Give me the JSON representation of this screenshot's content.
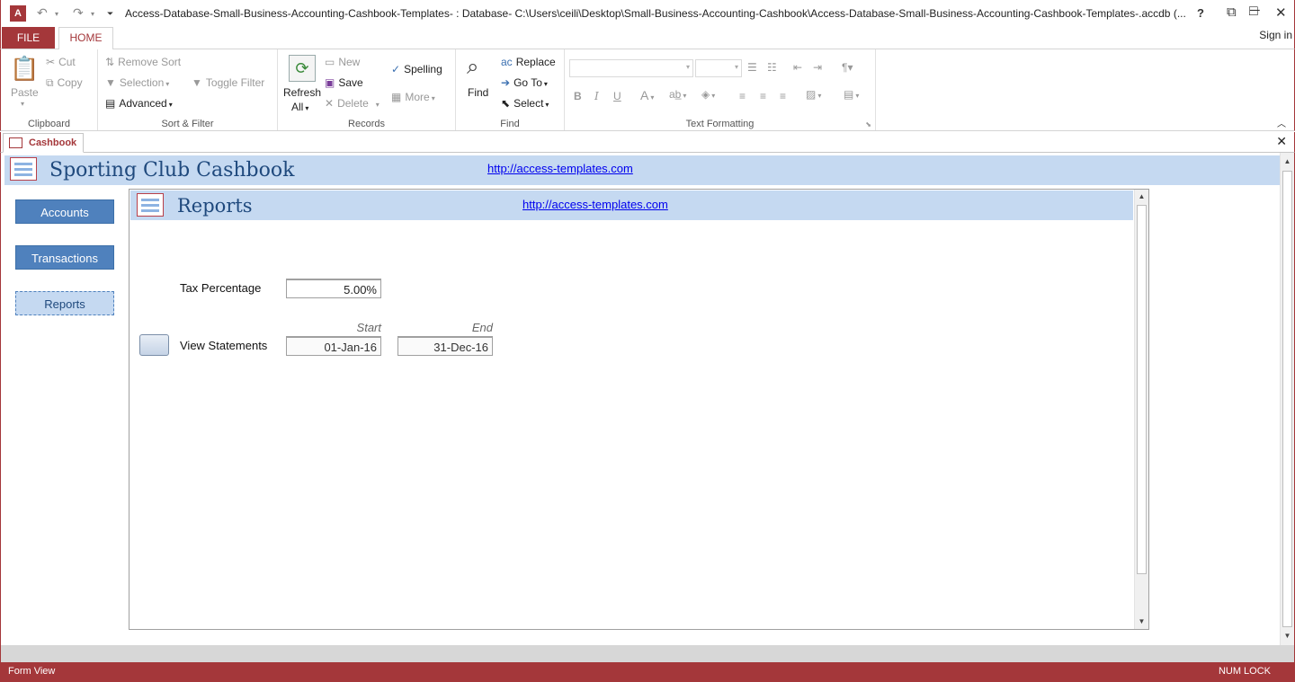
{
  "window": {
    "title": "Access-Database-Small-Business-Accounting-Cashbook-Templates- : Database- C:\\Users\\ceili\\Desktop\\Small-Business-Accounting-Cashbook\\Access-Database-Small-Business-Accounting-Cashbook-Templates-.accdb (...",
    "app_icon_text": "A",
    "help": "?",
    "minimize": "─",
    "maximize": "□",
    "close": "✕"
  },
  "ribbon_tabs": {
    "file": "FILE",
    "home": "HOME",
    "sign_in": "Sign in"
  },
  "ribbon": {
    "clipboard": {
      "label": "Clipboard",
      "paste": "Paste",
      "cut": "Cut",
      "copy": "Copy"
    },
    "sort_filter": {
      "label": "Sort & Filter",
      "remove_sort": "Remove Sort",
      "selection": "Selection",
      "advanced": "Advanced",
      "toggle_filter": "Toggle Filter"
    },
    "records": {
      "label": "Records",
      "refresh": "Refresh",
      "refresh_all": "All",
      "new": "New",
      "save": "Save",
      "delete": "Delete",
      "spelling": "Spelling",
      "more": "More"
    },
    "find": {
      "label": "Find",
      "find": "Find",
      "replace": "Replace",
      "go_to": "Go To",
      "select": "Select"
    },
    "text_formatting": {
      "label": "Text Formatting"
    }
  },
  "doc_tab": {
    "label": "Cashbook",
    "close": "✕"
  },
  "form": {
    "title": "Sporting Club Cashbook",
    "link": "http://access-templates.com",
    "nav": [
      "Accounts",
      "Transactions",
      "Reports"
    ]
  },
  "subform": {
    "title": "Reports",
    "link": "http://access-templates.com",
    "tax_label": "Tax Percentage",
    "tax_value": "5.00%",
    "view_label": "View Statements",
    "start_caption": "Start",
    "end_caption": "End",
    "start_value": "01-Jan-16",
    "end_value": "31-Dec-16"
  },
  "status": {
    "left": "Form View",
    "right": "NUM LOCK"
  },
  "colors": {
    "brand": "#a4373a",
    "header_band": "#c5d9f1",
    "nav_button": "#4f81bd",
    "title_text": "#1f497d"
  }
}
